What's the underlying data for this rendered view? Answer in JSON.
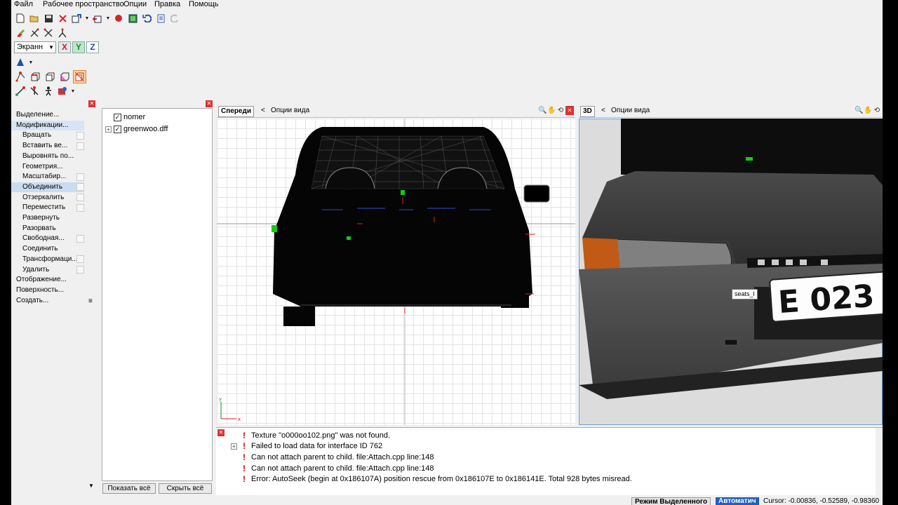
{
  "menu": [
    "Файл",
    "Рабочее пространство",
    "Опции",
    "Правка",
    "Помощь"
  ],
  "toolbar": {
    "coord_space": "Экранн",
    "axes": [
      "X",
      "Y",
      "Z"
    ]
  },
  "left_panel": {
    "items": [
      {
        "label": "Выделение...",
        "kind": "cat"
      },
      {
        "label": "Модификации...",
        "kind": "cat",
        "state": "highlighted"
      },
      {
        "label": "Вращать",
        "kind": "sub",
        "box": true
      },
      {
        "label": "Вставить ве...",
        "kind": "sub",
        "box": true
      },
      {
        "label": "Выровнять по...",
        "kind": "sub"
      },
      {
        "label": "Геометрия...",
        "kind": "sub"
      },
      {
        "label": "Масштабир...",
        "kind": "sub",
        "box": true
      },
      {
        "label": "Объединить",
        "kind": "sub",
        "box": true,
        "state": "selected"
      },
      {
        "label": "Отзеркалить",
        "kind": "sub",
        "box": true
      },
      {
        "label": "Переместить",
        "kind": "sub",
        "box": true
      },
      {
        "label": "Развернуть",
        "kind": "sub"
      },
      {
        "label": "Разорвать",
        "kind": "sub"
      },
      {
        "label": "Свободная...",
        "kind": "sub",
        "box": true
      },
      {
        "label": "Соединить",
        "kind": "sub"
      },
      {
        "label": "Трансформаци...",
        "kind": "sub",
        "box": true
      },
      {
        "label": "Удалить",
        "kind": "sub",
        "box": true
      },
      {
        "label": "Отображение...",
        "kind": "cat"
      },
      {
        "label": "Поверхность...",
        "kind": "cat"
      },
      {
        "label": "Создать...",
        "kind": "cat"
      }
    ]
  },
  "tree": {
    "items": [
      {
        "label": "nomer",
        "checked": true,
        "expandable": false
      },
      {
        "label": "greenwoo.dff",
        "checked": true,
        "expandable": true
      }
    ],
    "show_all": "Показать всё",
    "hide_all": "Скрыть всё"
  },
  "viewports": {
    "front": {
      "tab": "Спереди",
      "options": "Опции вида"
    },
    "persp": {
      "tab": "3D",
      "options": "Опции вида",
      "plate_text": "E 023",
      "tag": "seats_l"
    }
  },
  "log": [
    "Texture \"o000oo102.png\" was not found.",
    "Failed to load data for interface ID 762",
    "Can not attach parent to child. file:Attach.cpp line:148",
    "Can not attach parent to child. file:Attach.cpp line:148",
    "Error: AutoSeek (begin at 0x186107A) position rescue  from 0x186107E to 0x186141E. Total 928 bytes misread."
  ],
  "status": {
    "mode": "Режим Выделенного",
    "auto": "Автоматич",
    "cursor": "Cursor: -0.00836, -0.52589, -0.98360"
  },
  "colors": {
    "accent_orange": "#fbd7a0",
    "status_blue": "#1f5fbf",
    "close_red": "#dd3333",
    "warning_red": "#cc0000"
  }
}
